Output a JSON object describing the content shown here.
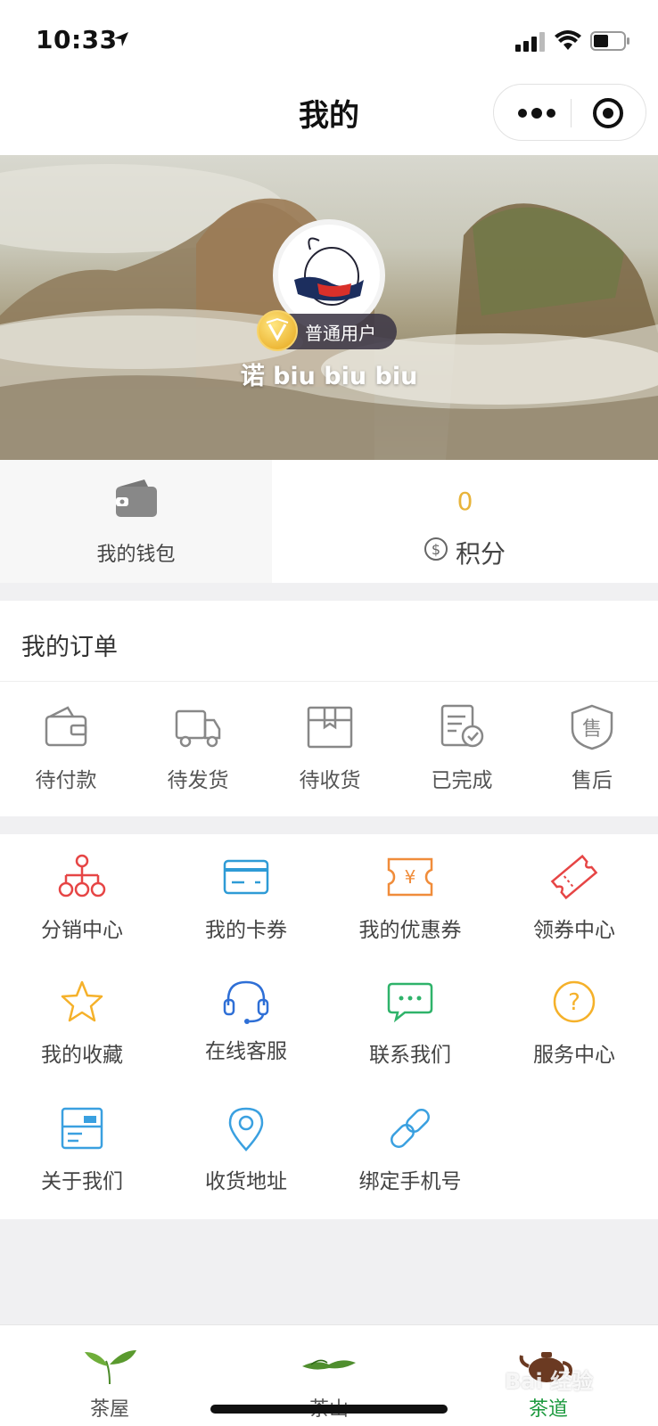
{
  "status_bar": {
    "time": "10:33"
  },
  "nav": {
    "title": "我的"
  },
  "profile": {
    "badge": "普通用户",
    "username": "诺 biu biu biu"
  },
  "wallet": {
    "label": "我的钱包"
  },
  "points": {
    "value": "0",
    "label": "积分"
  },
  "orders": {
    "title": "我的订单",
    "items": [
      {
        "label": "待付款",
        "icon": "wallet-icon"
      },
      {
        "label": "待发货",
        "icon": "truck-icon"
      },
      {
        "label": "待收货",
        "icon": "box-icon"
      },
      {
        "label": "已完成",
        "icon": "checked-doc-icon"
      },
      {
        "label": "售后",
        "icon": "shield-icon"
      }
    ]
  },
  "services": [
    {
      "label": "分销中心",
      "icon": "network-icon",
      "color": "#e64545"
    },
    {
      "label": "我的卡券",
      "icon": "card-icon",
      "color": "#2e9bd6"
    },
    {
      "label": "我的优惠券",
      "icon": "coupon-icon",
      "color": "#f08c3a"
    },
    {
      "label": "领券中心",
      "icon": "ticket-icon",
      "color": "#e64545"
    },
    {
      "label": "我的收藏",
      "icon": "star-icon",
      "color": "#f5b12a"
    },
    {
      "label": "在线客服",
      "icon": "headset-icon",
      "color": "#2e6fd6"
    },
    {
      "label": "联系我们",
      "icon": "chat-icon",
      "color": "#2fb36a"
    },
    {
      "label": "服务中心",
      "icon": "question-icon",
      "color": "#f5b12a"
    },
    {
      "label": "关于我们",
      "icon": "about-card-icon",
      "color": "#3aa0e0"
    },
    {
      "label": "收货地址",
      "icon": "location-icon",
      "color": "#3aa0e0"
    },
    {
      "label": "绑定手机号",
      "icon": "link-icon",
      "color": "#3aa0e0"
    }
  ],
  "tabbar": {
    "tabs": [
      {
        "label": "茶屋",
        "icon": "tea-sprout-icon",
        "active": false
      },
      {
        "label": "茶山",
        "icon": "tea-leaves-icon",
        "active": false
      },
      {
        "label": "茶道",
        "icon": "teapot-icon",
        "active": true
      }
    ],
    "active_color": "#1d9a3f"
  },
  "watermark": "Bai 经验"
}
